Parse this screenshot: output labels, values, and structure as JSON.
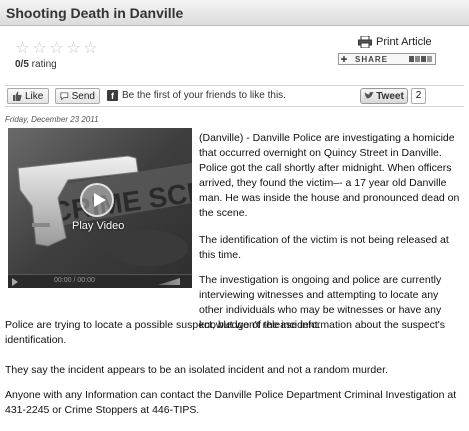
{
  "article": {
    "title": "Shooting Death in Danville",
    "date": "Friday, December 23 2011",
    "paragraphs": [
      "(Danville) -   Danville Police are investigating a homicide that occurred overnight on Quincy Street in Danville.  Police got the call shortly after midnight.   When officers arrived, they found the victim–- a 17 year old Danville man.  He was inside the house and pronounced dead on the scene.",
      "The identification of the victim is not being released  at this time.",
      "The investigation is ongoing and police are currently interviewing witnesses and attempting to locate any other individuals who may be witnesses or have any knowledge of the incident.",
      "Police are trying to locate a possible suspect, but won't release information about the suspect's identification.",
      "They say the incident appears to be an isolated incident and not a random murder.",
      " Anyone with any Information can contact the Danville Police Department Criminal Investigation at 431-2245 or Crime Stoppers at  446-TIPS."
    ]
  },
  "rating": {
    "value": "0/5",
    "label": " rating",
    "star_glyph": "☆",
    "stars_filled": 0,
    "stars_total": 5
  },
  "tools": {
    "print_label": "Print Article",
    "share_label": "SHARE",
    "share_symbol": "✚"
  },
  "social": {
    "like_label": "Like",
    "send_label": "Send",
    "fb_letter": "f",
    "fb_text": "Be the first of your friends to like this.",
    "tweet_label": "Tweet",
    "tweet_count": "2"
  },
  "video": {
    "play_label": "Play Video",
    "time_text": "00:00 / 00:00"
  },
  "icons": {
    "print": "printer-icon",
    "like": "thumbs-up-icon",
    "send": "speech-bubble-icon",
    "facebook": "facebook-icon",
    "twitter": "twitter-bird-icon",
    "play": "play-icon"
  }
}
